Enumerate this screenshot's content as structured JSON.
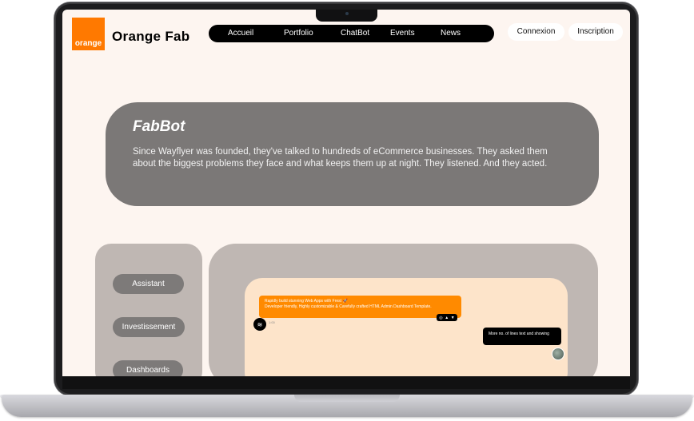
{
  "brand": {
    "logo_text": "orange",
    "name": "Orange Fab",
    "accent_color": "#ff7900"
  },
  "nav": {
    "items": [
      {
        "label": "Accueil"
      },
      {
        "label": "Portfolio"
      },
      {
        "label": "ChatBot"
      },
      {
        "label": "Events"
      },
      {
        "label": "News"
      }
    ],
    "login_label": "Connexion",
    "signup_label": "Inscription"
  },
  "hero": {
    "title": "FabBot",
    "text": "Since Wayflyer was founded, they've talked to hundreds of eCommerce businesses. They asked them about the biggest problems they face and what keeps them up at night. They listened. And they acted."
  },
  "sidebar": {
    "items": [
      {
        "label": "Assistant"
      },
      {
        "label": "Investissement"
      },
      {
        "label": "Dashboards"
      }
    ]
  },
  "chat": {
    "bot_message_line1": "Rapidly build stunning Web Apps with Frest 🚀",
    "bot_message_line2": "Developer friendly, Highly customizable & Carefully crafted HTML Admin Dashboard Template.",
    "bot_time": "1:00",
    "user_message": "More no. of lines text and showing"
  }
}
